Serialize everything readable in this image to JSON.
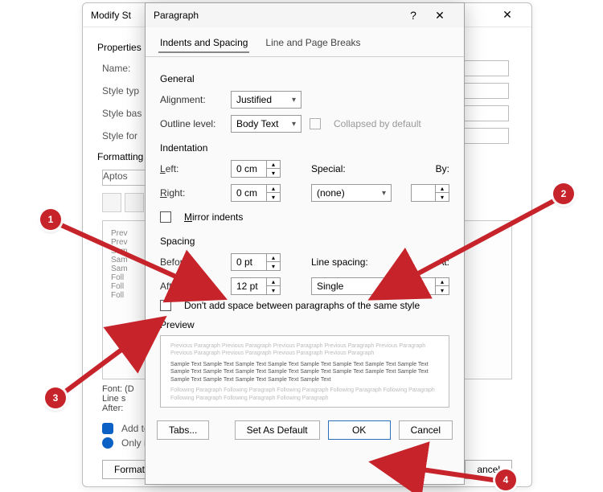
{
  "colors": {
    "annotation": "#c6232a"
  },
  "back": {
    "title": "Modify St",
    "section_props": "Properties",
    "name_lbl": "Name:",
    "styletype_lbl": "Style typ",
    "stylebased_lbl": "Style bas",
    "stylefor_lbl": "Style for",
    "section_fmt": "Formatting",
    "font_value": "Aptos",
    "preview_text": "Prev\nPrev\nSam\nSam\nSam\nFoll\nFoll\nFoll",
    "desc": "Font: (D\nLine s\nAfter:",
    "addto": "Add to",
    "onlyin": "Only in",
    "format_btn": "Format",
    "cancel_btn": "ancel"
  },
  "dlg": {
    "title": "Paragraph",
    "tabs": {
      "t1": "Indents and Spacing",
      "t2": "Line and Page Breaks"
    },
    "general": {
      "head": "General",
      "alignment_lbl": "Alignment:",
      "alignment_val": "Justified",
      "outline_lbl": "Outline level:",
      "outline_val": "Body Text",
      "collapsed_lbl": "Collapsed by default"
    },
    "indent": {
      "head": "Indentation",
      "left_lbl": "Left:",
      "left_val": "0 cm",
      "right_lbl": "Right:",
      "right_val": "0 cm",
      "special_lbl": "Special:",
      "special_val": "(none)",
      "by_lbl": "By:",
      "by_val": "",
      "mirror_lbl": "Mirror indents"
    },
    "spacing": {
      "head": "Spacing",
      "before_lbl": "Before:",
      "before_val": "0 pt",
      "after_lbl": "After:",
      "after_val": "12 pt",
      "linespacing_lbl": "Line spacing:",
      "linespacing_val": "Single",
      "at_lbl": "At:",
      "at_val": "",
      "dontadd_lbl": "Don't add space between paragraphs of the same style"
    },
    "preview": {
      "head": "Preview",
      "faint1": "Previous Paragraph Previous Paragraph Previous Paragraph Previous Paragraph Previous Paragraph Previous Paragraph Previous Paragraph Previous Paragraph Previous Paragraph",
      "sample": "Sample Text Sample Text Sample Text Sample Text Sample Text Sample Text Sample Text Sample Text Sample Text Sample Text Sample Text Sample Text Sample Text Sample Text Sample Text Sample Text Sample Text Sample Text Sample Text Sample Text Sample Text",
      "faint2": "Following Paragraph Following Paragraph Following Paragraph Following Paragraph Following Paragraph Following Paragraph Following Paragraph Following Paragraph"
    },
    "buttons": {
      "tabs": "Tabs...",
      "setdefault": "Set As Default",
      "ok": "OK",
      "cancel": "Cancel"
    }
  },
  "annotations": {
    "a1": "1",
    "a2": "2",
    "a3": "3",
    "a4": "4"
  }
}
